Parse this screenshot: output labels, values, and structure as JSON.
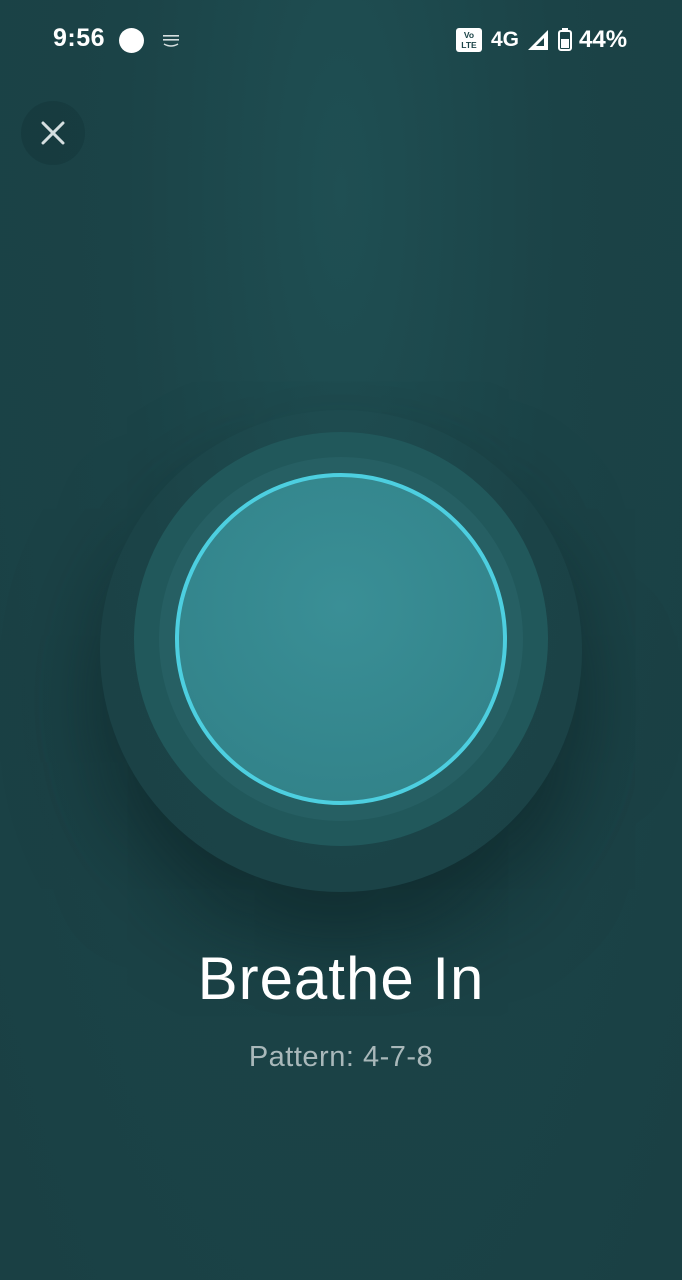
{
  "status_bar": {
    "time": "9:56",
    "volte_label_top": "Vo",
    "volte_label_bottom": "LTE",
    "network_type": "4G",
    "battery_percent": "44%",
    "icons": [
      "notification-dot-icon",
      "amazon-business-icon",
      "volte-icon",
      "signal-icon",
      "battery-icon"
    ]
  },
  "close_button": {
    "icon": "close-icon"
  },
  "exercise": {
    "phase": "Breathe In",
    "pattern": "Pattern: 4-7-8"
  },
  "colors": {
    "background": "#1b4347",
    "ring_outer": "#21585b",
    "ring_middle": "#265f63",
    "circle_fill": "#34868d",
    "circle_stroke": "#4dcfe0",
    "pattern_text": "#a9b8ba"
  }
}
